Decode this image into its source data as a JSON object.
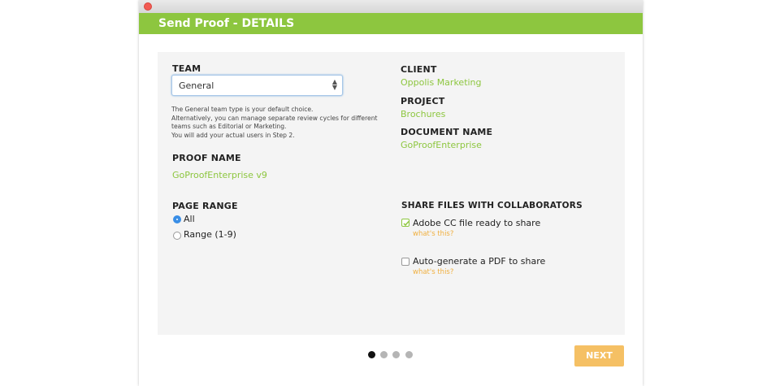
{
  "dialog": {
    "title": "Send Proof - DETAILS"
  },
  "team": {
    "label": "TEAM",
    "selected": "General",
    "help_lines": [
      "The General team type is your default choice.",
      "Alternatively, you can manage separate review cycles for different",
      "teams such as Editorial or Marketing.",
      "You will add your actual users in Step 2."
    ]
  },
  "client": {
    "label": "CLIENT",
    "value": "Oppolis Marketing"
  },
  "project": {
    "label": "PROJECT",
    "value": "Brochures"
  },
  "document": {
    "label": "DOCUMENT NAME",
    "value": "GoProofEnterprise"
  },
  "proof_name": {
    "label": "PROOF NAME",
    "value": "GoProofEnterprise v9"
  },
  "page_range": {
    "label": "PAGE RANGE",
    "options": [
      {
        "label": "All",
        "checked": true
      },
      {
        "label": "Range (1-9)",
        "checked": false
      }
    ]
  },
  "share": {
    "label": "SHARE FILES WITH COLLABORATORS",
    "options": [
      {
        "label": "Adobe CC file ready to share",
        "checked": true,
        "help": "what's this?"
      },
      {
        "label": "Auto-generate a PDF to share",
        "checked": false,
        "help": "what's this?"
      }
    ]
  },
  "pagination": {
    "total": 4,
    "current": 1
  },
  "buttons": {
    "next": "NEXT"
  },
  "colors": {
    "accent": "#8dc63f",
    "button": "#f5c064",
    "link": "#f0b040",
    "radio": "#3a8ee6"
  }
}
